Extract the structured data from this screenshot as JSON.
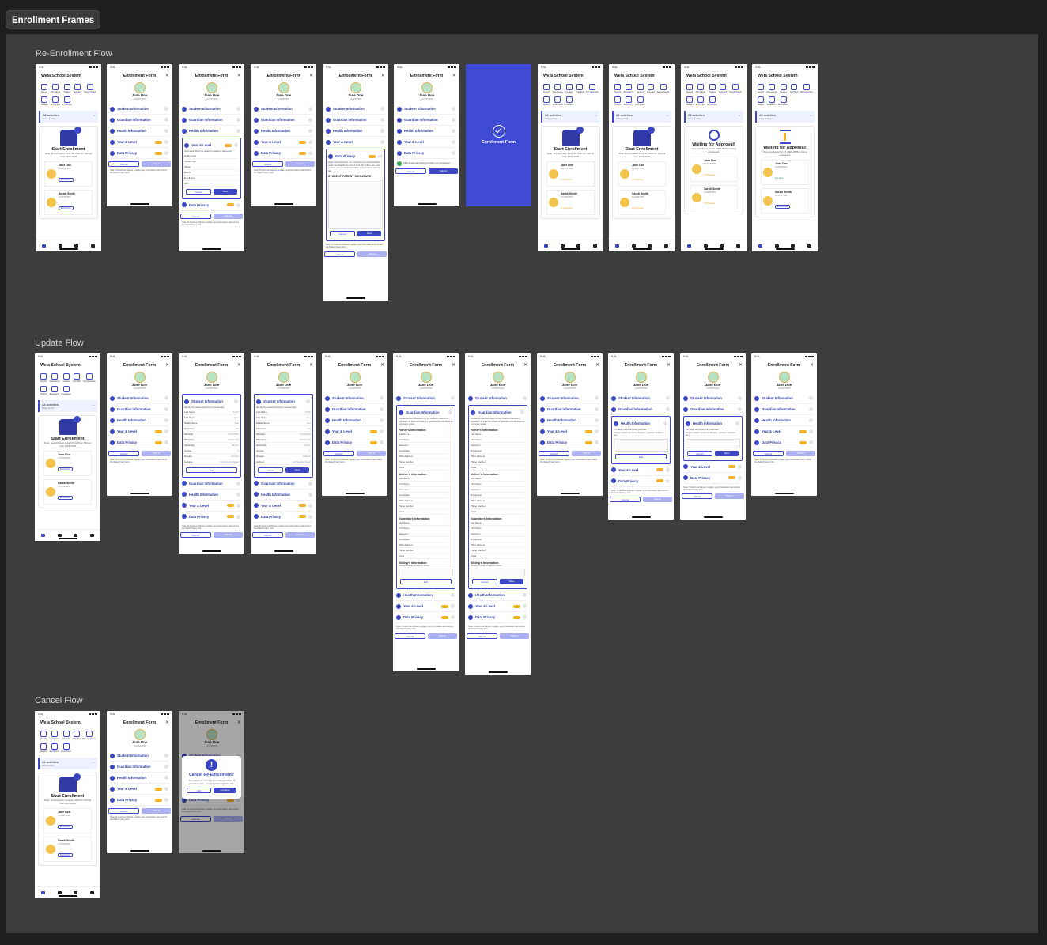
{
  "board_title": "Enrollment Frames",
  "flows": {
    "reenrollment": "Re-Enrollment Flow",
    "update": "Update Flow",
    "cancel": "Cancel Flow"
  },
  "ui": {
    "time": "9:41",
    "app_title": "Wela School System",
    "form_title": "Enrollment Form",
    "close_glyph": "✕",
    "grid_labels": [
      "Events",
      "Attendance",
      "Grades",
      "Enrolled",
      "Transportation",
      "Subject",
      "Enrollment",
      "Enrollment"
    ],
    "activities_title": "All activities",
    "activities_sub": "Daily activity",
    "start_enrollment": "Start Enrollment",
    "start_note": "Note: Enroll before June 30, 2025 for School Year 2025-2026",
    "waiting": "Waiting for Approval!",
    "waiting_note": "Your enrollment for SY 2025-2026 is being processed.",
    "student1_name": "Jane Doe",
    "student1_id": "1234567890",
    "student2_name": "Sarah Smith",
    "student2_id": "1234567852",
    "enroll_now": "Enroll Now",
    "in_progress": "In Progress",
    "enrolled": "Enrolled",
    "profile_name": "Jane Doe",
    "profile_id": "1234567890",
    "sections": [
      "Student Information",
      "Guardian Information",
      "Health Information",
      "Year & Level",
      "Data Privacy"
    ],
    "btn_cancel": "Cancel",
    "btn_submit": "Submit",
    "btn_save": "Save",
    "btn_edit": "Edit",
    "btn_continue": "Continue",
    "note_text": "Note: To finish enrollment, update your information and confirm the Data Privacy form.",
    "year_level_text": "Information about the student's academic placement.",
    "year_fields": [
      "Grade Level",
      "School Year",
      "Status",
      "Branch",
      "Enrollment",
      "LRN"
    ],
    "privacy_text": "Wela School Systems, Inc. recognizes its responsibilities under the Data Privacy Act of 2012. We collect, use, and process your personal information in accordance with the law.",
    "signature_label": "STUDENT/PARENT SIGNATURE",
    "all_set": "All set! Just tap Submit to finish your enrollment.",
    "splash_text": "Enrollment Form",
    "student_info_text": "Identify the student and basic personal data.",
    "student_fields": [
      "Last Name",
      "First Name",
      "Middle Name",
      "Extension",
      "Birthdate",
      "Birthplace",
      "Nationality",
      "Gender",
      "Religion",
      "Address"
    ],
    "student_values": [
      "Smith",
      "Jane",
      "Doe",
      "N/A",
      "01/01/2010",
      "Manila City",
      "Filipino",
      "F",
      "Catholic",
      "123 Sample Street"
    ],
    "guardian_text": "Provide contact information for the student's parents or guardians. At least one parent or guardian must be listed as a primary contact.",
    "father_info": "Father's Information",
    "mother_info": "Mother's Information",
    "guardian_info": "Guardian's Information",
    "sibling_info": "Sibling's Information",
    "sibling_text": "Sibling currently enrolled in school",
    "parent_fields": [
      "Last Name",
      "First Name",
      "Extension",
      "Occupation",
      "Office Address",
      "Phone Number",
      "Email"
    ],
    "health_text": "For safety and emergency purposes.",
    "health_value": "Student Health Concerns (Allergies, medical conditions, etc.)",
    "cancel_modal_title": "Cancel Re-Enrollment?",
    "cancel_modal_body": "You haven't finished your enrollment form. If you leave now, your progress might be lost.",
    "modal_icon": "!"
  },
  "colors": {
    "primary": "#3b47c4",
    "splash": "#3f4bd4",
    "warning": "#f3b22e",
    "success": "#2ba34b",
    "canvas": "#3d3d3d",
    "background": "#1e1e1e"
  }
}
